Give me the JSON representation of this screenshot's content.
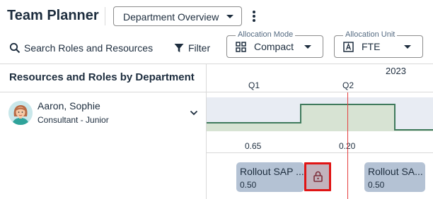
{
  "header": {
    "title": "Team Planner",
    "view_select": "Department Overview"
  },
  "toolbar": {
    "search_label": "Search Roles and Resources",
    "filter_label": "Filter",
    "allocation_mode": {
      "label": "Allocation Mode",
      "value": "Compact"
    },
    "allocation_unit": {
      "label": "Allocation Unit",
      "value": "FTE"
    }
  },
  "grid": {
    "column_header": "Resources and Roles by Department",
    "year": "2023",
    "quarters": [
      "Q1",
      "Q2"
    ]
  },
  "resource": {
    "name": "Aaron, Sophie",
    "role": "Consultant - Junior",
    "utilization": [
      "0.65",
      "0.20"
    ],
    "assignments": [
      {
        "title": "Rollout SAP ...",
        "value": "0.50"
      },
      {
        "title": "Rollout SA...",
        "value": "0.50"
      }
    ]
  },
  "icons": {
    "search": "search-icon",
    "filter": "filter-icon",
    "mode": "grid-icon",
    "unit": "fte-icon",
    "lock": "lock-icon",
    "more": "more-vertical-icon",
    "expand": "chevron-down-icon"
  },
  "colors": {
    "accent_line": "#e54040",
    "chart_line": "#3f7a5c",
    "chart_fill": "#d7e3d3",
    "chart_bg": "#e8ecf3",
    "assignment_bg": "#b4c2d4",
    "lock_border": "#e01414"
  }
}
